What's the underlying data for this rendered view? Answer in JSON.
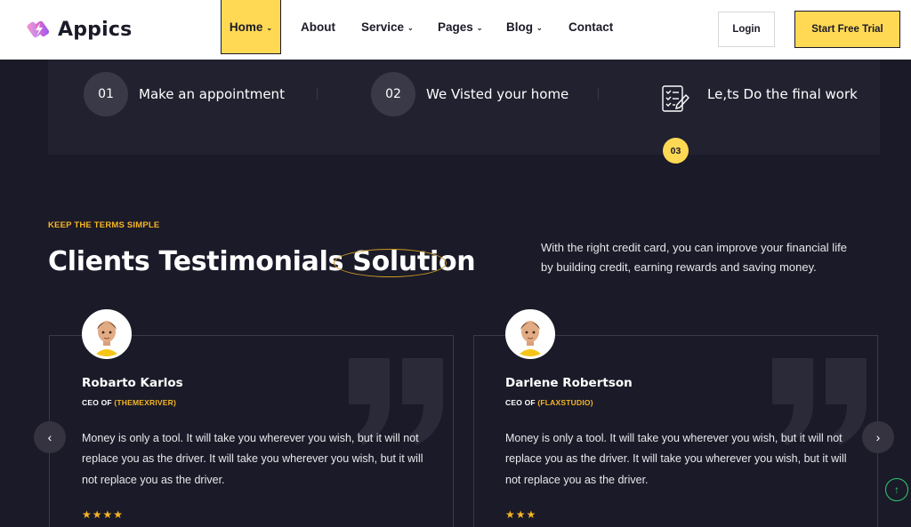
{
  "brand": {
    "name": "Appics",
    "accent": "#ffd954",
    "highlight": "#f5b625"
  },
  "nav": {
    "home": "Home",
    "about": "About",
    "service": "Service",
    "pages": "Pages",
    "blog": "Blog",
    "contact": "Contact",
    "login": "Login",
    "trial": "Start Free Trial"
  },
  "steps": [
    {
      "num": "01",
      "label": "Make an appointment"
    },
    {
      "num": "02",
      "label": "We Visted your home"
    },
    {
      "num": "03",
      "label": "Le,ts Do the final work",
      "icon": "checklist-icon"
    }
  ],
  "section": {
    "eyebrow": "KEEP THE TERMS SIMPLE",
    "title_main": "Clients Testimonials ",
    "title_highlight": "Solution",
    "intro": "With the right credit card, you can improve your financial life by building credit, earning rewards and saving money."
  },
  "testimonials": [
    {
      "name": "Robarto Karlos",
      "role_prefix": "CEO OF ",
      "company": "(THEMEXRIVER)",
      "text": "Money is only a tool. It will take you wherever you wish, but it will not replace you as the driver. It will take you wherever you wish, but it will not replace you as the driver.",
      "stars": "★★★★",
      "rating": 4
    },
    {
      "name": "Darlene Robertson",
      "role_prefix": "CEO OF ",
      "company": "(FLAXSTUDIO)",
      "text": "Money is only a tool. It will take you wherever you wish, but it will not replace you as the driver. It will take you wherever you wish, but it will not replace you as the driver.",
      "stars": "★★★",
      "rating": 3
    }
  ],
  "controls": {
    "prev": "‹",
    "next": "›",
    "top": "↑"
  }
}
